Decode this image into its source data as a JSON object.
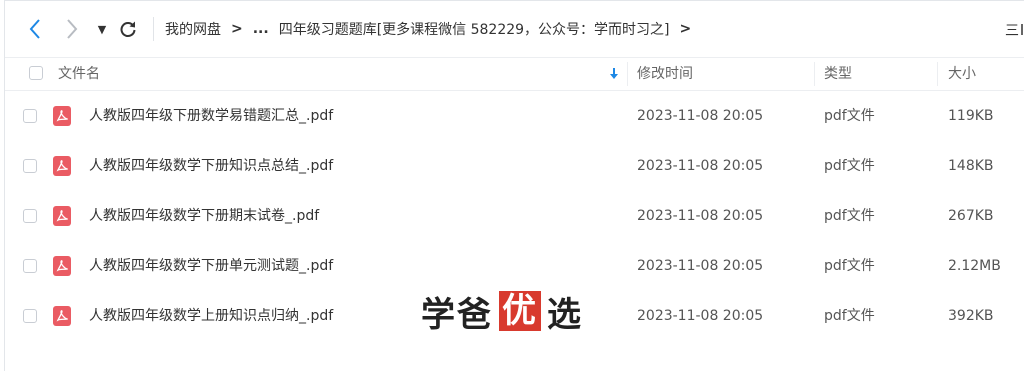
{
  "breadcrumb": {
    "root": "我的网盘",
    "ellipsis": "...",
    "current": "四年级习题题库[更多课程微信 582229，公众号：学而时习之]",
    "sep": ">"
  },
  "toolbar": {
    "view_label": "三"
  },
  "columns": {
    "name": "文件名",
    "modified": "修改时间",
    "type": "类型",
    "size": "大小"
  },
  "files": [
    {
      "name": "人教版四年级下册数学易错题汇总_.pdf",
      "modified": "2023-11-08 20:05",
      "type": "pdf文件",
      "size": "119KB"
    },
    {
      "name": "人教版四年级数学下册知识点总结_.pdf",
      "modified": "2023-11-08 20:05",
      "type": "pdf文件",
      "size": "148KB"
    },
    {
      "name": "人教版四年级数学下册期末试卷_.pdf",
      "modified": "2023-11-08 20:05",
      "type": "pdf文件",
      "size": "267KB"
    },
    {
      "name": "人教版四年级数学下册单元测试题_.pdf",
      "modified": "2023-11-08 20:05",
      "type": "pdf文件",
      "size": "2.12MB"
    },
    {
      "name": "人教版四年级数学上册知识点归纳_.pdf",
      "modified": "2023-11-08 20:05",
      "type": "pdf文件",
      "size": "392KB"
    }
  ],
  "watermark": {
    "part1": "学爸",
    "part2": "优",
    "part3": "选"
  },
  "colors": {
    "accent": "#1e88e5",
    "pdf": "#ea5b63",
    "watermark": "#d83a2e"
  }
}
